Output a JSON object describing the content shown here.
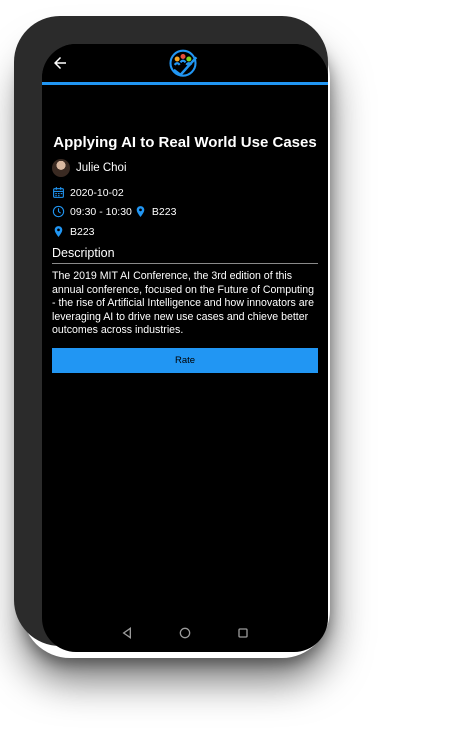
{
  "event": {
    "title": "Applying AI to Real World Use Cases",
    "speaker": "Julie Choi",
    "date": "2020-10-02",
    "time": "09:30 - 10:30",
    "room": "B223",
    "location": "B223"
  },
  "description": {
    "heading": "Description",
    "text": "The 2019 MIT AI Conference, the 3rd edition of this annual conference, focused on the Future of Computing - the rise of Artificial Intelligence and how innovators are leveraging AI to drive new use cases and chieve better outcomes across industries."
  },
  "actions": {
    "rate_label": "Rate"
  },
  "colors": {
    "accent": "#2196f3",
    "background": "#000000",
    "frame": "#2b2b2b"
  },
  "icons": {
    "back": "arrow-left-icon",
    "logo": "people-check-logo",
    "calendar": "calendar-icon",
    "clock": "clock-icon",
    "pin": "location-pin-icon",
    "nav_back": "triangle-back-icon",
    "nav_home": "circle-home-icon",
    "nav_recent": "square-recent-icon"
  }
}
